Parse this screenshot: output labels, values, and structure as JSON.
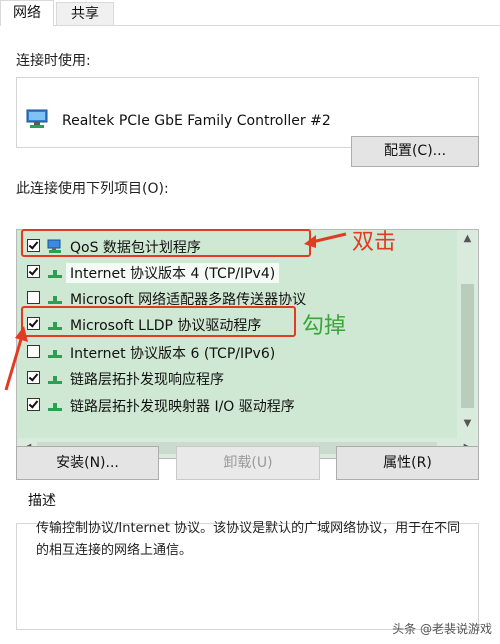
{
  "tabs": [
    {
      "label": "网络",
      "active": true
    },
    {
      "label": "共享",
      "active": false
    }
  ],
  "connect_using_label": "连接时使用:",
  "adapter": {
    "name": "Realtek PCIe GbE Family Controller #2",
    "icon": "network-adapter-icon"
  },
  "configure_button": "配置(C)...",
  "items_label": "此连接使用下列项目(O):",
  "items": [
    {
      "label": "QoS 数据包计划程序",
      "checked": true,
      "icon": "qos-icon"
    },
    {
      "label": "Internet 协议版本 4 (TCP/IPv4)",
      "checked": true,
      "icon": "protocol-icon"
    },
    {
      "label": "Microsoft 网络适配器多路传送器协议",
      "checked": false,
      "icon": "protocol-icon"
    },
    {
      "label": "Microsoft LLDP 协议驱动程序",
      "checked": true,
      "icon": "protocol-icon"
    },
    {
      "label": "Internet 协议版本 6 (TCP/IPv6)",
      "checked": false,
      "icon": "protocol-icon"
    },
    {
      "label": "链路层拓扑发现响应程序",
      "checked": true,
      "icon": "protocol-icon"
    },
    {
      "label": "链路层拓扑发现映射器 I/O 驱动程序",
      "checked": true,
      "icon": "protocol-icon"
    }
  ],
  "buttons": {
    "install": "安装(N)...",
    "uninstall": "卸载(U)",
    "properties": "属性(R)"
  },
  "description": {
    "title": "描述",
    "text": "传输控制协议/Internet 协议。该协议是默认的广域网络协议，用于在不同的相互连接的网络上通信。"
  },
  "annotations": {
    "double_click": "双击",
    "uncheck": "勾掉"
  },
  "colors": {
    "list_bg": "#cfe8d3",
    "annotation_red": "#e23b22",
    "annotation_green": "#3aa53a"
  },
  "watermark": "头条 @老裴说游戏"
}
